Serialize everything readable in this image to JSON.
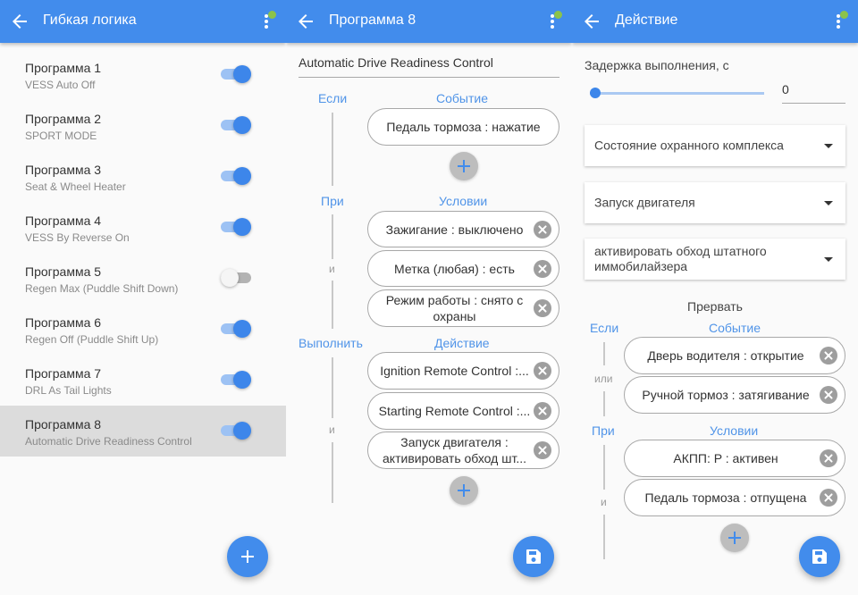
{
  "colors": {
    "primary": "#428cec",
    "accent_label": "#5094e8",
    "badge": "#8bc34a",
    "selected_row": "#dcdcdc"
  },
  "screen1": {
    "title": "Гибкая логика",
    "icons": {
      "back": "arrow-left-icon",
      "menu": "more-vert-icon",
      "fab": "plus-icon"
    },
    "programs": [
      {
        "name": "Программа 1",
        "desc": "VESS Auto Off",
        "enabled": true,
        "selected": false
      },
      {
        "name": "Программа 2",
        "desc": "SPORT MODE",
        "enabled": true,
        "selected": false
      },
      {
        "name": "Программа 3",
        "desc": "Seat & Wheel Heater",
        "enabled": true,
        "selected": false
      },
      {
        "name": "Программа 4",
        "desc": "VESS By Reverse On",
        "enabled": true,
        "selected": false
      },
      {
        "name": "Программа 5",
        "desc": "Regen Max (Puddle Shift Down)",
        "enabled": false,
        "selected": false
      },
      {
        "name": "Программа 6",
        "desc": "Regen Off (Puddle Shift Up)",
        "enabled": true,
        "selected": false
      },
      {
        "name": "Программа 7",
        "desc": "DRL As Tail Lights",
        "enabled": true,
        "selected": false
      },
      {
        "name": "Программа 8",
        "desc": "Automatic Drive Readiness Control",
        "enabled": true,
        "selected": true
      }
    ]
  },
  "screen2": {
    "title": "Программа 8",
    "program_name": "Automatic Drive Readiness Control",
    "if_label": "Если",
    "event_header": "Событие",
    "events": [
      "Педаль тормоза : нажатие"
    ],
    "when_label": "При",
    "condition_header": "Условии",
    "conditions": [
      "Зажигание : выключено",
      "Метка (любая) : есть",
      "Режим работы : снято с охраны"
    ],
    "and_label": "и",
    "do_label": "Выполнить",
    "action_header": "Действие",
    "actions": [
      "Ignition Remote Control :...",
      "Starting Remote Control :...",
      "Запуск двигателя : активировать обход шт..."
    ],
    "icons": {
      "fab": "save-icon"
    }
  },
  "screen3": {
    "title": "Действие",
    "delay_label": "Задержка выполнения, с",
    "delay_value": "0",
    "delay_slider_fraction": 0,
    "dropdowns": [
      "Состояние охранного комплекса",
      "Запуск двигателя",
      "активировать обход штатного иммобилайзера"
    ],
    "abort_title": "Прервать",
    "if_label": "Если",
    "event_header": "Событие",
    "events": [
      "Дверь водителя : открытие",
      "Ручной тормоз : затягивание"
    ],
    "or_label": "или",
    "when_label": "При",
    "condition_header": "Условии",
    "conditions": [
      "АКПП: P : активен",
      "Педаль тормоза : отпущена"
    ],
    "and_label": "и",
    "icons": {
      "fab": "save-icon"
    }
  }
}
